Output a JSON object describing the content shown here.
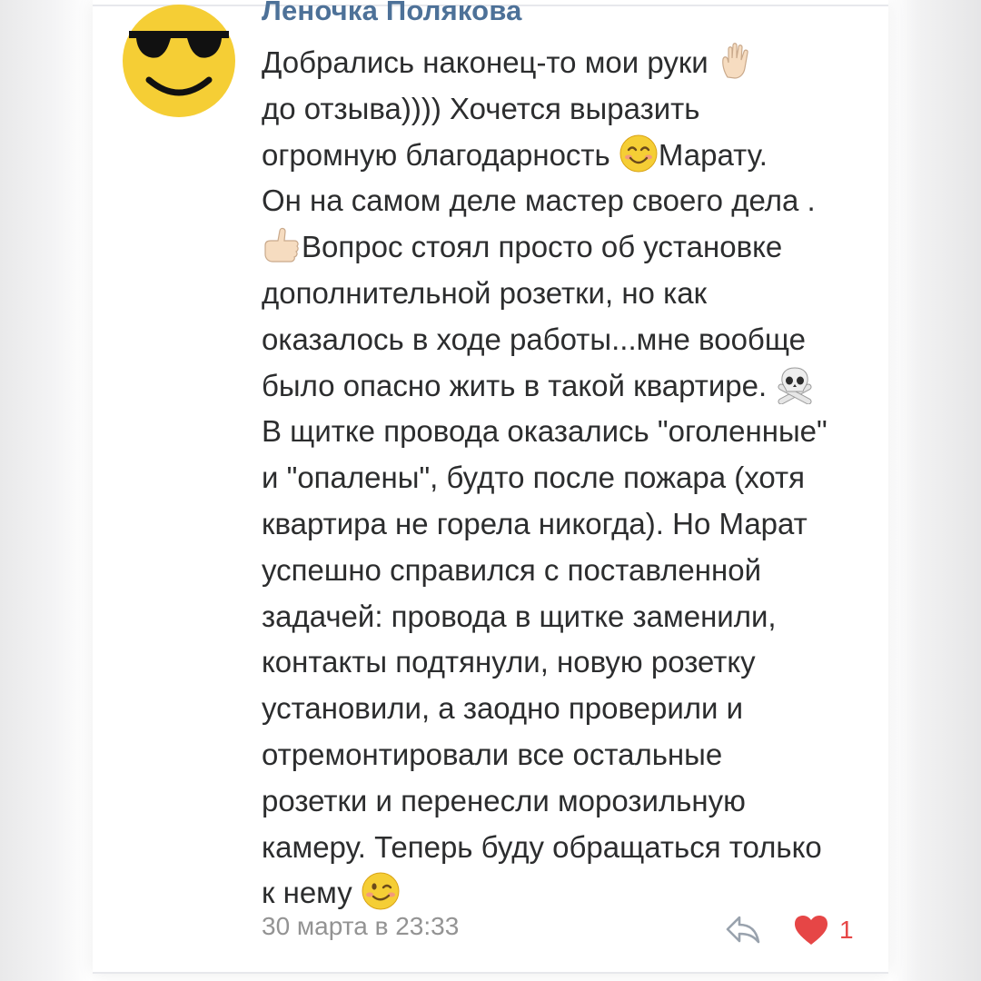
{
  "comment": {
    "author": "Леночка Полякова",
    "avatar_icon": "sunglasses-emoji-icon",
    "lines": [
      "Добрались наконец-то мои руки ",
      "до отзыва)))) Хочется выразить",
      "огромную благодарность ",
      "Марату.",
      "Он на самом деле мастер своего дела .",
      "Вопрос стоял просто об установке",
      "дополнительной розетки, но как",
      "оказалось в ходе работы...мне вообще",
      "было опасно жить в такой квартире. ",
      "В щитке провода оказались \"оголенные\"",
      "и \"опалены\", будто после пожара (хотя",
      "квартира не горела никогда). Но Марат",
      "успешно справился с поставленной",
      "задачей: провода в щитке заменили,",
      "контакты подтянули, новую розетку",
      "установили, а заодно проверили и",
      "отремонтировали все остальные",
      "розетки и перенесли морозильную",
      "камеру. Теперь буду обращаться только",
      "к нему "
    ],
    "emojis": {
      "hand": "raised-hand-icon",
      "smile": "smiling-face-icon",
      "thumbs": "thumbs-up-icon",
      "skull": "skull-crossbones-icon",
      "wink": "winking-face-icon"
    },
    "timestamp": "30 марта в 23:33",
    "reply_icon": "reply-arrow-icon",
    "like_icon": "heart-icon",
    "like_count": "1"
  },
  "colors": {
    "author": "#4d7198",
    "text": "#2c2d2e",
    "meta": "#939393",
    "like": "#e64646",
    "emoji_yellow": "#f5ce35"
  }
}
